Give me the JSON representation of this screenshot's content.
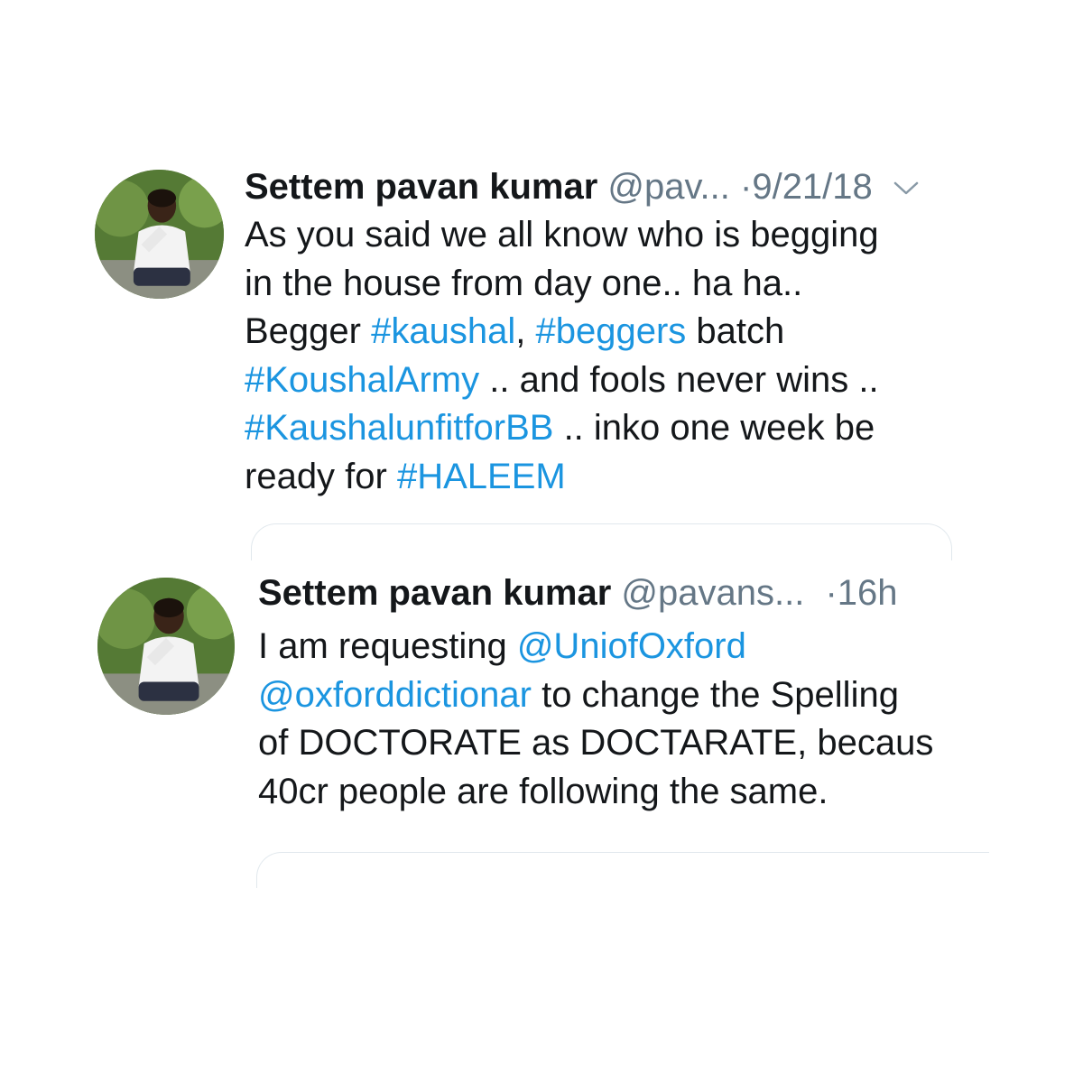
{
  "tweets": [
    {
      "name": "Settem pavan kumar",
      "handle": "@pav...",
      "dot": "·",
      "time": "9/21/18",
      "lines": [
        [
          {
            "t": "As you said we all know who is begging",
            "link": false
          }
        ],
        [
          {
            "t": "in the house from day one.. ha ha..",
            "link": false
          }
        ],
        [
          {
            "t": "Begger ",
            "link": false
          },
          {
            "t": "#kaushal",
            "link": true
          },
          {
            "t": ", ",
            "link": false
          },
          {
            "t": "#beggers",
            "link": true
          },
          {
            "t": " batch",
            "link": false
          }
        ],
        [
          {
            "t": "#KoushalArmy",
            "link": true
          },
          {
            "t": " .. and fools never wins ..",
            "link": false
          }
        ],
        [
          {
            "t": "#KaushalunfitforBB",
            "link": true
          },
          {
            "t": " .. inko one week be",
            "link": false
          }
        ],
        [
          {
            "t": "ready for ",
            "link": false
          },
          {
            "t": "#HALEEM",
            "link": true
          }
        ]
      ]
    },
    {
      "name": "Settem pavan kumar",
      "handle": "@pavans...",
      "dot": "·",
      "time": "16h",
      "lines": [
        [
          {
            "t": "I am requesting ",
            "link": false
          },
          {
            "t": "@UniofOxford",
            "link": true
          }
        ],
        [
          {
            "t": "@oxforddictionar",
            "link": true
          },
          {
            "t": " to change the Spelling",
            "link": false
          }
        ],
        [
          {
            "t": "of DOCTORATE as DOCTARATE, becaus",
            "link": false
          }
        ],
        [
          {
            "t": "40cr people are following the same.",
            "link": false
          }
        ]
      ]
    }
  ],
  "colors": {
    "text": "#14171a",
    "secondary": "#657786",
    "link": "#1b95e0",
    "border": "#e1e8ed"
  },
  "icons": {
    "chevron": "chevron-down-icon",
    "avatar": "avatar"
  }
}
